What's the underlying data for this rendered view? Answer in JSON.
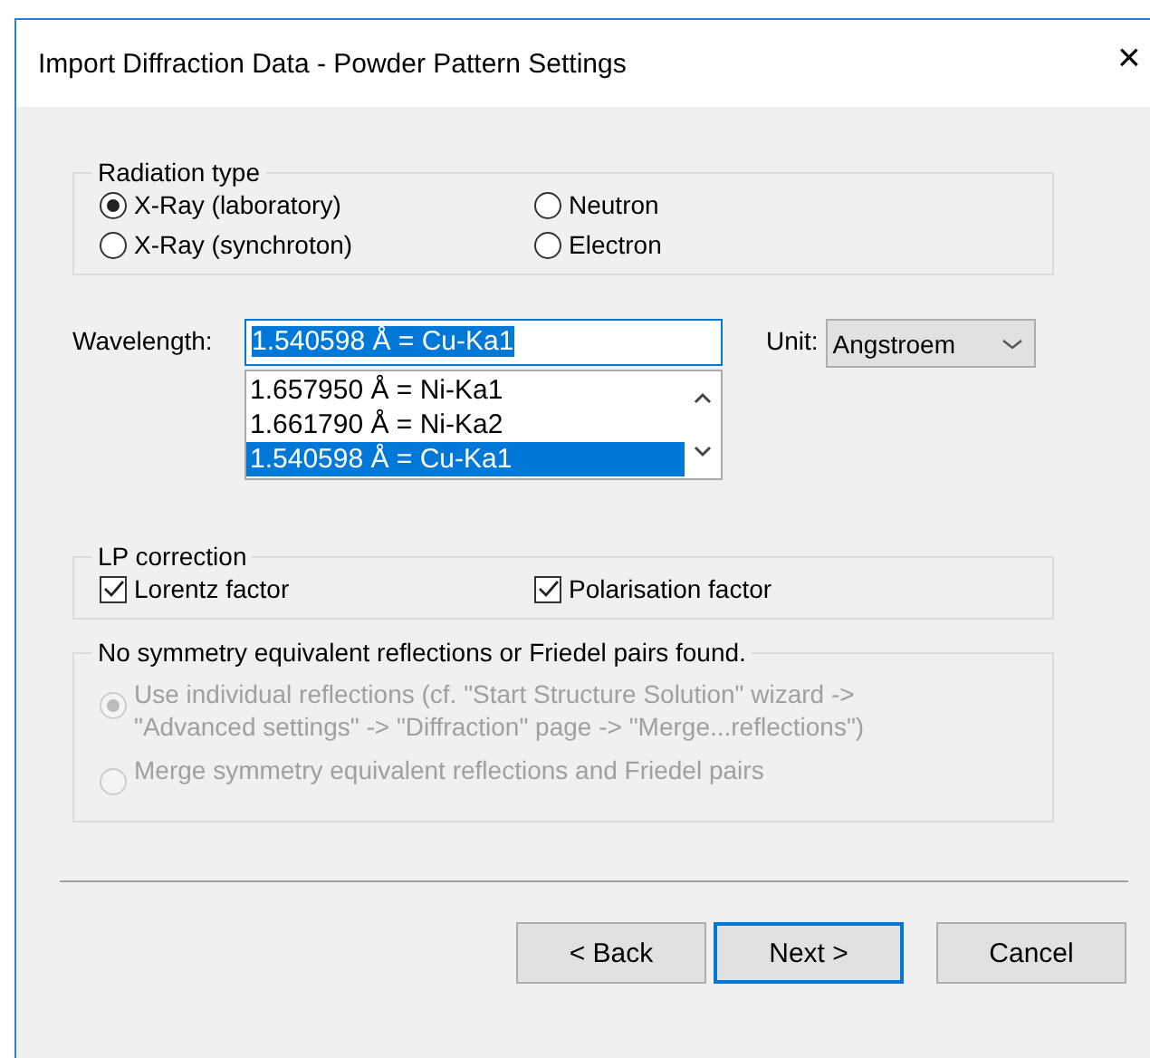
{
  "window": {
    "title": "Import Diffraction Data - Powder Pattern Settings",
    "close": "×"
  },
  "radiation": {
    "title": "Radiation type",
    "options": [
      {
        "label": "X-Ray (laboratory)",
        "selected": true
      },
      {
        "label": "Neutron",
        "selected": false
      },
      {
        "label": "X-Ray (synchroton)",
        "selected": false
      },
      {
        "label": "Electron",
        "selected": false
      }
    ]
  },
  "wavelength": {
    "label": "Wavelength:",
    "value": "1.540598 Å = Cu-Ka1",
    "value_selected": true,
    "list": [
      {
        "label": "1.657950 Å = Ni-Ka1",
        "selected": false
      },
      {
        "label": "1.661790 Å = Ni-Ka2",
        "selected": false
      },
      {
        "label": "1.540598 Å = Cu-Ka1",
        "selected": true
      }
    ]
  },
  "unit": {
    "label": "Unit:",
    "value": "Angstroem"
  },
  "lp": {
    "title": "LP correction",
    "options": [
      {
        "label": "Lorentz factor",
        "checked": true
      },
      {
        "label": "Polarisation factor",
        "checked": true
      }
    ]
  },
  "symmetry": {
    "title": "No symmetry equivalent reflections or Friedel pairs found.",
    "options": [
      {
        "label": "Use individual reflections (cf. \"Start Structure Solution\" wizard ->\n\"Advanced settings\" -> \"Diffraction\" page -> \"Merge...reflections\")",
        "selected": true,
        "disabled": true
      },
      {
        "label": "Merge symmetry equivalent reflections and Friedel pairs",
        "selected": false,
        "disabled": true
      }
    ]
  },
  "buttons": [
    {
      "label": "< Back",
      "default": false
    },
    {
      "label": "Next >",
      "default": true
    },
    {
      "label": "Cancel",
      "default": false
    }
  ]
}
